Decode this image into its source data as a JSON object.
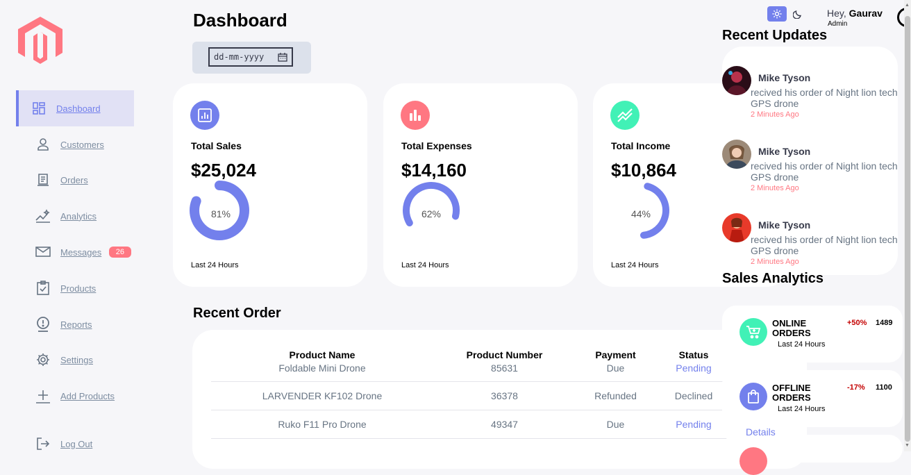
{
  "header": {
    "title": "Dashboard",
    "date_placeholder": "dd-mm-yyyy"
  },
  "sidebar": {
    "items": [
      {
        "label": "Dashboard",
        "icon": "dashboard-icon"
      },
      {
        "label": "Customers",
        "icon": "person-icon"
      },
      {
        "label": "Orders",
        "icon": "receipt-icon"
      },
      {
        "label": "Analytics",
        "icon": "insights-icon"
      },
      {
        "label": "Messages",
        "icon": "mail-icon",
        "badge": "26"
      },
      {
        "label": "Products",
        "icon": "clipboard-check-icon"
      },
      {
        "label": "Reports",
        "icon": "report-icon"
      },
      {
        "label": "Settings",
        "icon": "gear-icon"
      },
      {
        "label": "Add Products",
        "icon": "plus-icon"
      },
      {
        "label": "Log Out",
        "icon": "logout-icon"
      }
    ]
  },
  "cards": [
    {
      "label": "Total Sales",
      "amount": "$25,024",
      "percent": "81%",
      "progress": 0.81,
      "footer": "Last 24 Hours",
      "color": "#7380ec",
      "icon": "bar-chart-icon"
    },
    {
      "label": "Total Expenses",
      "amount": "$14,160",
      "percent": "62%",
      "progress": 0.62,
      "footer": "Last 24 Hours",
      "color": "#ff7782",
      "icon": "stats-icon"
    },
    {
      "label": "Total Income",
      "amount": "$10,864",
      "percent": "44%",
      "progress": 0.44,
      "footer": "Last 24 Hours",
      "color": "#41f1b6",
      "icon": "trending-up-icon"
    }
  ],
  "recent_order": {
    "title": "Recent Order",
    "columns": [
      "Product Name",
      "Product Number",
      "Payment",
      "Status"
    ],
    "rows": [
      {
        "name": "Foldable Mini Drone",
        "number": "85631",
        "payment": "Due",
        "status": "Pending"
      },
      {
        "name": "LARVENDER KF102 Drone",
        "number": "36378",
        "payment": "Refunded",
        "status": "Declined"
      },
      {
        "name": "Ruko F11 Pro Drone",
        "number": "49347",
        "payment": "Due",
        "status": "Pending"
      }
    ],
    "details_label": "Details"
  },
  "top": {
    "greeting": "Hey, ",
    "user": "Gaurav",
    "role": "Admin"
  },
  "recent_updates": {
    "title": "Recent Updates",
    "items": [
      {
        "name": "Mike Tyson",
        "message": "recived his order of Night lion tech GPS drone",
        "time": "2 Minutes Ago"
      },
      {
        "name": "Mike Tyson",
        "message": "recived his order of Night lion tech GPS drone",
        "time": "2 Minutes Ago"
      },
      {
        "name": "Mike Tyson",
        "message": "recived his order of Night lion tech GPS drone",
        "time": "2 Minutes Ago"
      }
    ]
  },
  "sales_analytics": {
    "title": "Sales Analytics",
    "items": [
      {
        "title": "ONLINE ORDERS",
        "sub": "Last 24 Hours",
        "change": "+50%",
        "value": "1489",
        "color": "#41f1b6",
        "change_color": "#c40000"
      },
      {
        "title": "OFFLINE ORDERS",
        "sub": "Last 24 Hours",
        "change": "-17%",
        "value": "1100",
        "color": "#7380ec",
        "change_color": "#c40000"
      }
    ]
  },
  "colors": {
    "primary": "#7380ec",
    "danger": "#ff7782",
    "success": "#41f1b6"
  }
}
